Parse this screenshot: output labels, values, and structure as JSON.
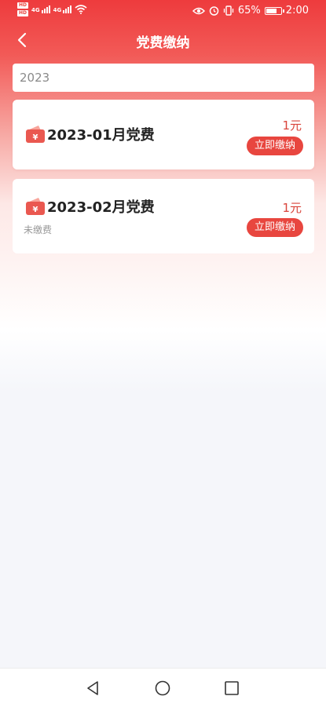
{
  "status_bar": {
    "hd_1": "HD",
    "hd_2": "HD",
    "signal_1": "4G",
    "signal_2": "4G",
    "battery_percent": "65%",
    "battery_level": 0.65,
    "time": "2:00"
  },
  "nav": {
    "title": "党费缴纳"
  },
  "filter": {
    "year": "2023"
  },
  "fees": [
    {
      "period": "2023-01月党费",
      "status": "",
      "amount": "1元",
      "button": "立即缴纳"
    },
    {
      "period": "2023-02月党费",
      "status": "未缴费",
      "amount": "1元",
      "button": "立即缴纳"
    }
  ],
  "colors": {
    "primary": "#e8463f",
    "amount": "#d9443b"
  },
  "icons": {
    "back": "chevron-left-icon",
    "wallet": "wallet-yuan-icon",
    "nav_back": "triangle-back-icon",
    "nav_home": "circle-home-icon",
    "nav_recent": "square-recent-icon"
  }
}
